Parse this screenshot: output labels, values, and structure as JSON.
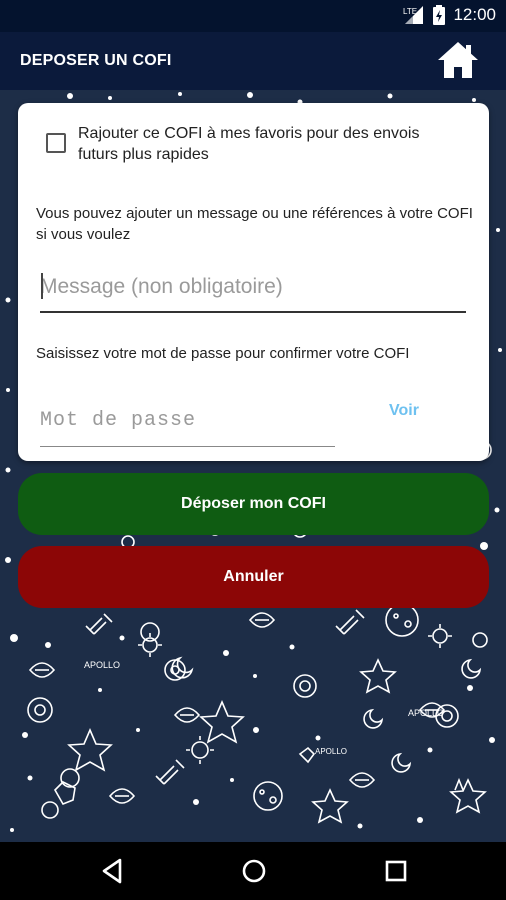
{
  "status_bar": {
    "time": "12:00",
    "network_label": "LTE",
    "icons": [
      "lte-icon",
      "signal-icon",
      "battery-icon"
    ]
  },
  "app_bar": {
    "title": "DEPOSER UN COFI",
    "home_icon": "home-icon"
  },
  "form": {
    "favorite_label": "Rajouter ce COFI à mes favoris pour des envois futurs plus rapides",
    "favorite_checked": false,
    "message_intro": "Vous pouvez ajouter un message ou une références à votre COFI si vous voulez",
    "message_placeholder": "Message (non obligatoire)",
    "message_value": "",
    "password_intro": "Saisissez votre mot de passe pour confirmer votre COFI",
    "password_placeholder": "Mot de passe",
    "password_value": "",
    "show_password_label": "Voir"
  },
  "buttons": {
    "deposit_label": "Déposer mon COFI",
    "cancel_label": "Annuler"
  },
  "background": {
    "pattern_text": "APOLLO"
  },
  "nav_bar": {
    "items": [
      "back-icon",
      "home-circle-icon",
      "recents-icon"
    ]
  },
  "colors": {
    "status_bar": "#04132e",
    "app_bar": "#0b1a3b",
    "pattern_bg": "#1d2d47",
    "deposit": "#0f5c12",
    "cancel": "#8c0606",
    "link": "#6ec1f0"
  }
}
